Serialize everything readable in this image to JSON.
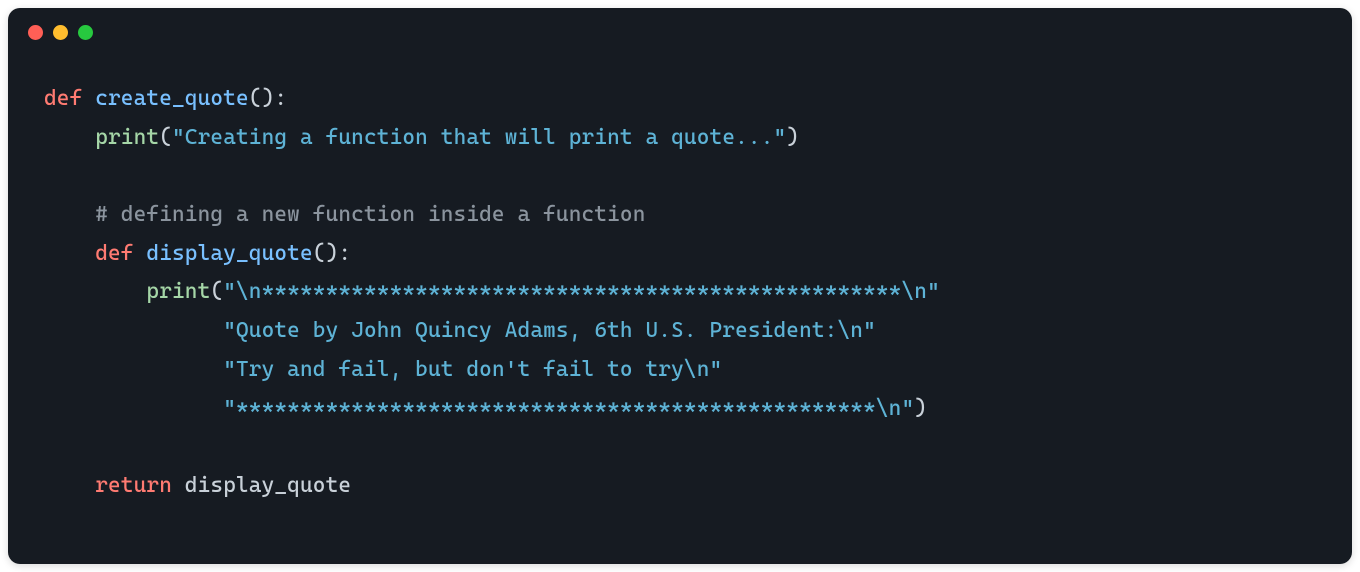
{
  "colors": {
    "bg": "#161b22",
    "red": "#ff5f56",
    "yellow": "#ffbd2e",
    "green": "#27c93f",
    "keyword": "#ff7b72",
    "funcdef": "#79c0ff",
    "call": "#a5d6a7",
    "string": "#5eb3d6",
    "comment": "#8b949e",
    "punct": "#c9d1d9"
  },
  "code": {
    "language": "python",
    "lines": [
      {
        "indent": 0,
        "tokens": [
          {
            "t": "def ",
            "c": "keyword"
          },
          {
            "t": "create_quote",
            "c": "funcdef"
          },
          {
            "t": "():",
            "c": "punct"
          }
        ]
      },
      {
        "indent": 1,
        "tokens": [
          {
            "t": "print",
            "c": "call"
          },
          {
            "t": "(",
            "c": "punct"
          },
          {
            "t": "\"Creating a function that will print a quote...\"",
            "c": "string"
          },
          {
            "t": ")",
            "c": "punct"
          }
        ]
      },
      {
        "indent": 0,
        "tokens": []
      },
      {
        "indent": 1,
        "tokens": [
          {
            "t": "# defining a new function inside a function",
            "c": "comment"
          }
        ]
      },
      {
        "indent": 1,
        "tokens": [
          {
            "t": "def ",
            "c": "keyword"
          },
          {
            "t": "display_quote",
            "c": "funcdef"
          },
          {
            "t": "():",
            "c": "punct"
          }
        ]
      },
      {
        "indent": 2,
        "tokens": [
          {
            "t": "print",
            "c": "call"
          },
          {
            "t": "(",
            "c": "punct"
          },
          {
            "t": "\"\\n**************************************************\\n\"",
            "c": "string"
          }
        ]
      },
      {
        "indent": 3,
        "tokens": [
          {
            "t": "  ",
            "c": "punct"
          },
          {
            "t": "\"Quote by John Quincy Adams, 6th U.S. President:\\n\"",
            "c": "string"
          }
        ]
      },
      {
        "indent": 3,
        "tokens": [
          {
            "t": "  ",
            "c": "punct"
          },
          {
            "t": "\"Try and fail, but don't fail to try\\n\"",
            "c": "string"
          }
        ]
      },
      {
        "indent": 3,
        "tokens": [
          {
            "t": "  ",
            "c": "punct"
          },
          {
            "t": "\"**************************************************\\n\"",
            "c": "string"
          },
          {
            "t": ")",
            "c": "punct"
          }
        ]
      },
      {
        "indent": 0,
        "tokens": []
      },
      {
        "indent": 1,
        "tokens": [
          {
            "t": "return ",
            "c": "keyword"
          },
          {
            "t": "display_quote",
            "c": "ident"
          }
        ]
      }
    ]
  }
}
